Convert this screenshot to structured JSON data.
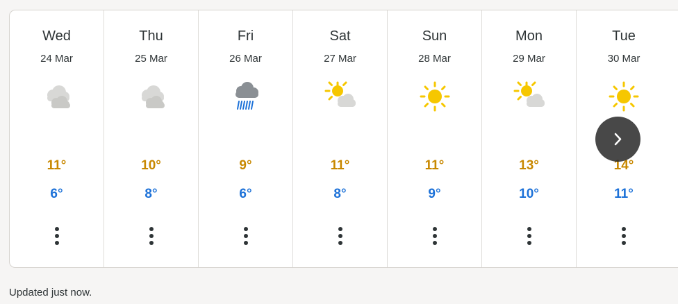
{
  "colors": {
    "high_temp": "#c88800",
    "low_temp": "#1c71d8",
    "sun": "#f6c700",
    "cloud": "#d8d8d6",
    "rain_cloud": "#8a8f94",
    "rain": "#1c71d8"
  },
  "forecast": {
    "days": [
      {
        "name": "Wed",
        "date": "24 Mar",
        "icon": "cloudy-icon",
        "high": "11°",
        "low": "6°",
        "more_icon": "more-vertical-icon"
      },
      {
        "name": "Thu",
        "date": "25 Mar",
        "icon": "cloudy-icon",
        "high": "10°",
        "low": "8°",
        "more_icon": "more-vertical-icon"
      },
      {
        "name": "Fri",
        "date": "26 Mar",
        "icon": "rain-icon",
        "high": "9°",
        "low": "6°",
        "more_icon": "more-vertical-icon"
      },
      {
        "name": "Sat",
        "date": "27 Mar",
        "icon": "partly-sunny-icon",
        "high": "11°",
        "low": "8°",
        "more_icon": "more-vertical-icon"
      },
      {
        "name": "Sun",
        "date": "28 Mar",
        "icon": "sunny-icon",
        "high": "11°",
        "low": "9°",
        "more_icon": "more-vertical-icon"
      },
      {
        "name": "Mon",
        "date": "29 Mar",
        "icon": "partly-sunny-icon",
        "high": "13°",
        "low": "10°",
        "more_icon": "more-vertical-icon"
      },
      {
        "name": "Tue",
        "date": "30 Mar",
        "icon": "sunny-icon",
        "high": "14°",
        "low": "11°",
        "more_icon": "more-vertical-icon"
      }
    ],
    "next_icon": "chevron-right-icon"
  },
  "footer": {
    "status": "Updated just now."
  }
}
